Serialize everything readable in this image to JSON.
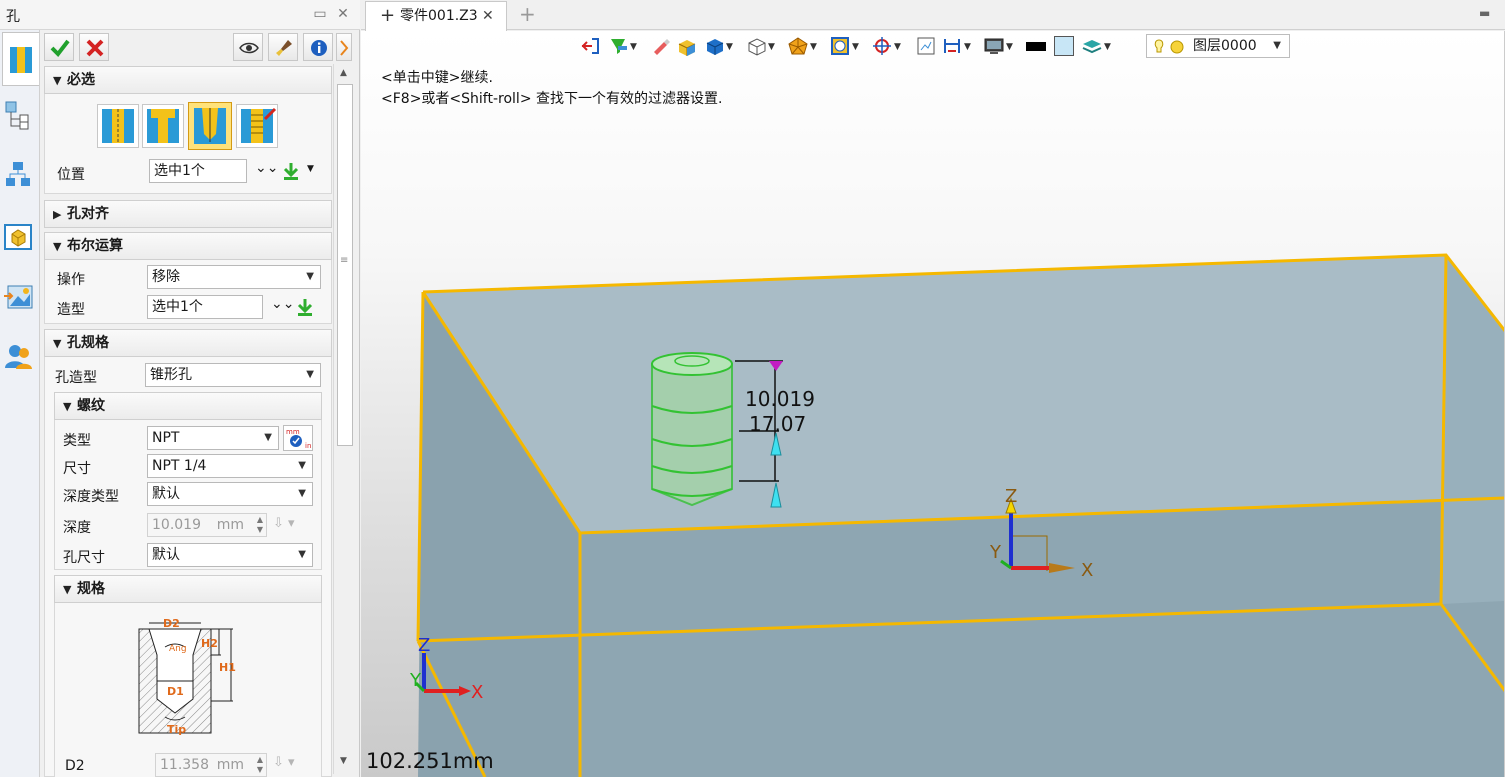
{
  "panel": {
    "title": "孔",
    "buttons": {
      "ok": "确定",
      "cancel": "取消"
    },
    "groups": {
      "required": {
        "label": "必选",
        "hole_types": [
          "simple-hole-icon",
          "counterbore-hole-icon",
          "tapered-hole-icon",
          "threaded-hole-icon"
        ],
        "position_label": "位置",
        "position_value": "选中1个"
      },
      "hole_align": {
        "label": "孔对齐"
      },
      "boolean": {
        "label": "布尔运算",
        "operation_label": "操作",
        "operation_value": "移除",
        "shape_label": "造型",
        "shape_value": "选中1个"
      },
      "hole_spec": {
        "label": "孔规格",
        "hole_type_label": "孔造型",
        "hole_type_value": "锥形孔",
        "thread": {
          "label": "螺纹",
          "type_label": "类型",
          "type_value": "NPT",
          "size_label": "尺寸",
          "size_value": "NPT 1/4",
          "depth_type_label": "深度类型",
          "depth_type_value": "默认",
          "depth_label": "深度",
          "depth_value": "10.019",
          "depth_unit": "mm",
          "hole_size_label": "孔尺寸",
          "hole_size_value": "默认"
        },
        "spec": {
          "label": "规格",
          "diagram_labels": {
            "d2": "D2",
            "ang": "Ang",
            "h2": "H2",
            "h1": "H1",
            "d1": "D1",
            "tip": "Tip"
          },
          "d2_label": "D2",
          "d2_value": "11.358",
          "d2_unit": "mm"
        }
      }
    }
  },
  "doc_tab": {
    "label": "零件001.Z3"
  },
  "viewport": {
    "hint_line1": "<单击中键>继续.",
    "hint_line2": "<F8>或者<Shift-roll> 查找下一个有效的过滤器设置.",
    "layer": "图层0000",
    "dim_depth": "10.019",
    "dim_total": "17.07",
    "axis_x": "X",
    "axis_y": "Y",
    "axis_z": "Z",
    "scale": "102.251mm"
  },
  "colors": {
    "edge_highlight": "#f5b800",
    "face": "#a9bcc6",
    "hole": "#7ee07e",
    "accent_blue": "#1e6fc8"
  }
}
